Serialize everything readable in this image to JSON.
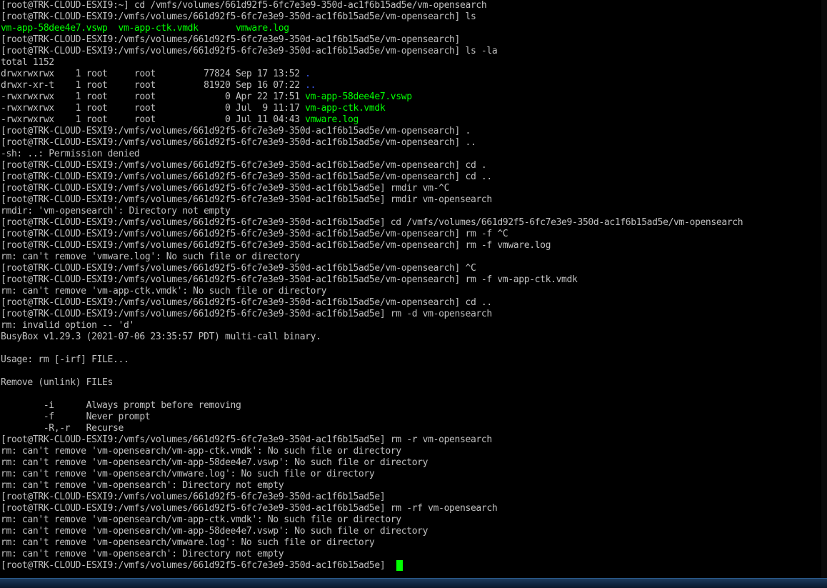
{
  "terminal": {
    "lines": [
      [
        {
          "text": "[root@TRK-CLOUD-ESXI9:~] cd /vmfs/volumes/661d92f5-6fc7e3e9-350d-ac1f6b15ad5e/vm-opensearch",
          "color": "default"
        }
      ],
      [
        {
          "text": "[root@TRK-CLOUD-ESXI9:/vmfs/volumes/661d92f5-6fc7e3e9-350d-ac1f6b15ad5e/vm-opensearch] ls",
          "color": "default"
        }
      ],
      [
        {
          "text": "vm-app-58dee4e7.vswp  vm-app-ctk.vmdk       vmware.log",
          "color": "green"
        }
      ],
      [
        {
          "text": "[root@TRK-CLOUD-ESXI9:/vmfs/volumes/661d92f5-6fc7e3e9-350d-ac1f6b15ad5e/vm-opensearch]",
          "color": "default"
        }
      ],
      [
        {
          "text": "[root@TRK-CLOUD-ESXI9:/vmfs/volumes/661d92f5-6fc7e3e9-350d-ac1f6b15ad5e/vm-opensearch] ls -la",
          "color": "default"
        }
      ],
      [
        {
          "text": "total 1152",
          "color": "default"
        }
      ],
      [
        {
          "text": "drwxrwxrwx    1 root     root         77824 Sep 17 13:52 ",
          "color": "default"
        },
        {
          "text": ".",
          "color": "blue"
        }
      ],
      [
        {
          "text": "drwxr-xr-t    1 root     root         81920 Sep 16 07:22 ",
          "color": "default"
        },
        {
          "text": "..",
          "color": "blue"
        }
      ],
      [
        {
          "text": "-rwxrwxrwx    1 root     root             0 Apr 22 17:51 ",
          "color": "default"
        },
        {
          "text": "vm-app-58dee4e7.vswp",
          "color": "green"
        }
      ],
      [
        {
          "text": "-rwxrwxrwx    1 root     root             0 Jul  9 11:17 ",
          "color": "default"
        },
        {
          "text": "vm-app-ctk.vmdk",
          "color": "green"
        }
      ],
      [
        {
          "text": "-rwxrwxrwx    1 root     root             0 Jul 11 04:43 ",
          "color": "default"
        },
        {
          "text": "vmware.log",
          "color": "green"
        }
      ],
      [
        {
          "text": "[root@TRK-CLOUD-ESXI9:/vmfs/volumes/661d92f5-6fc7e3e9-350d-ac1f6b15ad5e/vm-opensearch] .",
          "color": "default"
        }
      ],
      [
        {
          "text": "[root@TRK-CLOUD-ESXI9:/vmfs/volumes/661d92f5-6fc7e3e9-350d-ac1f6b15ad5e/vm-opensearch] ..",
          "color": "default"
        }
      ],
      [
        {
          "text": "-sh: ..: Permission denied",
          "color": "default"
        }
      ],
      [
        {
          "text": "[root@TRK-CLOUD-ESXI9:/vmfs/volumes/661d92f5-6fc7e3e9-350d-ac1f6b15ad5e/vm-opensearch] cd .",
          "color": "default"
        }
      ],
      [
        {
          "text": "[root@TRK-CLOUD-ESXI9:/vmfs/volumes/661d92f5-6fc7e3e9-350d-ac1f6b15ad5e/vm-opensearch] cd ..",
          "color": "default"
        }
      ],
      [
        {
          "text": "[root@TRK-CLOUD-ESXI9:/vmfs/volumes/661d92f5-6fc7e3e9-350d-ac1f6b15ad5e] rmdir vm-^C",
          "color": "default"
        }
      ],
      [
        {
          "text": "[root@TRK-CLOUD-ESXI9:/vmfs/volumes/661d92f5-6fc7e3e9-350d-ac1f6b15ad5e] rmdir vm-opensearch",
          "color": "default"
        }
      ],
      [
        {
          "text": "rmdir: 'vm-opensearch': Directory not empty",
          "color": "default"
        }
      ],
      [
        {
          "text": "[root@TRK-CLOUD-ESXI9:/vmfs/volumes/661d92f5-6fc7e3e9-350d-ac1f6b15ad5e] cd /vmfs/volumes/661d92f5-6fc7e3e9-350d-ac1f6b15ad5e/vm-opensearch",
          "color": "default"
        }
      ],
      [
        {
          "text": "[root@TRK-CLOUD-ESXI9:/vmfs/volumes/661d92f5-6fc7e3e9-350d-ac1f6b15ad5e/vm-opensearch] rm -f ^C",
          "color": "default"
        }
      ],
      [
        {
          "text": "[root@TRK-CLOUD-ESXI9:/vmfs/volumes/661d92f5-6fc7e3e9-350d-ac1f6b15ad5e/vm-opensearch] rm -f vmware.log",
          "color": "default"
        }
      ],
      [
        {
          "text": "rm: can't remove 'vmware.log': No such file or directory",
          "color": "default"
        }
      ],
      [
        {
          "text": "[root@TRK-CLOUD-ESXI9:/vmfs/volumes/661d92f5-6fc7e3e9-350d-ac1f6b15ad5e/vm-opensearch] ^C",
          "color": "default"
        }
      ],
      [
        {
          "text": "[root@TRK-CLOUD-ESXI9:/vmfs/volumes/661d92f5-6fc7e3e9-350d-ac1f6b15ad5e/vm-opensearch] rm -f vm-app-ctk.vmdk",
          "color": "default"
        }
      ],
      [
        {
          "text": "rm: can't remove 'vm-app-ctk.vmdk': No such file or directory",
          "color": "default"
        }
      ],
      [
        {
          "text": "[root@TRK-CLOUD-ESXI9:/vmfs/volumes/661d92f5-6fc7e3e9-350d-ac1f6b15ad5e/vm-opensearch] cd ..",
          "color": "default"
        }
      ],
      [
        {
          "text": "[root@TRK-CLOUD-ESXI9:/vmfs/volumes/661d92f5-6fc7e3e9-350d-ac1f6b15ad5e] rm -d vm-opensearch",
          "color": "default"
        }
      ],
      [
        {
          "text": "rm: invalid option -- 'd'",
          "color": "default"
        }
      ],
      [
        {
          "text": "BusyBox v1.29.3 (2021-07-06 23:35:57 PDT) multi-call binary.",
          "color": "default"
        }
      ],
      [
        {
          "text": "",
          "color": "default"
        }
      ],
      [
        {
          "text": "Usage: rm [-irf] FILE...",
          "color": "default"
        }
      ],
      [
        {
          "text": "",
          "color": "default"
        }
      ],
      [
        {
          "text": "Remove (unlink) FILEs",
          "color": "default"
        }
      ],
      [
        {
          "text": "",
          "color": "default"
        }
      ],
      [
        {
          "text": "        -i      Always prompt before removing",
          "color": "default"
        }
      ],
      [
        {
          "text": "        -f      Never prompt",
          "color": "default"
        }
      ],
      [
        {
          "text": "        -R,-r   Recurse",
          "color": "default"
        }
      ],
      [
        {
          "text": "[root@TRK-CLOUD-ESXI9:/vmfs/volumes/661d92f5-6fc7e3e9-350d-ac1f6b15ad5e] rm -r vm-opensearch",
          "color": "default"
        }
      ],
      [
        {
          "text": "rm: can't remove 'vm-opensearch/vm-app-ctk.vmdk': No such file or directory",
          "color": "default"
        }
      ],
      [
        {
          "text": "rm: can't remove 'vm-opensearch/vm-app-58dee4e7.vswp': No such file or directory",
          "color": "default"
        }
      ],
      [
        {
          "text": "rm: can't remove 'vm-opensearch/vmware.log': No such file or directory",
          "color": "default"
        }
      ],
      [
        {
          "text": "rm: can't remove 'vm-opensearch': Directory not empty",
          "color": "default"
        }
      ],
      [
        {
          "text": "[root@TRK-CLOUD-ESXI9:/vmfs/volumes/661d92f5-6fc7e3e9-350d-ac1f6b15ad5e]",
          "color": "default"
        }
      ],
      [
        {
          "text": "[root@TRK-CLOUD-ESXI9:/vmfs/volumes/661d92f5-6fc7e3e9-350d-ac1f6b15ad5e] rm -rf vm-opensearch",
          "color": "default"
        }
      ],
      [
        {
          "text": "rm: can't remove 'vm-opensearch/vm-app-ctk.vmdk': No such file or directory",
          "color": "default"
        }
      ],
      [
        {
          "text": "rm: can't remove 'vm-opensearch/vm-app-58dee4e7.vswp': No such file or directory",
          "color": "default"
        }
      ],
      [
        {
          "text": "rm: can't remove 'vm-opensearch/vmware.log': No such file or directory",
          "color": "default"
        }
      ],
      [
        {
          "text": "rm: can't remove 'vm-opensearch': Directory not empty",
          "color": "default"
        }
      ],
      [
        {
          "text": "[root@TRK-CLOUD-ESXI9:/vmfs/volumes/661d92f5-6fc7e3e9-350d-ac1f6b15ad5e] ",
          "color": "default"
        }
      ]
    ],
    "cursor_color": "#00ff00"
  },
  "colors": {
    "background": "#000000",
    "default_text": "#c0c0c0",
    "green": "#00ff00",
    "blue": "#3f5fff",
    "taskbar": "#10253f"
  }
}
